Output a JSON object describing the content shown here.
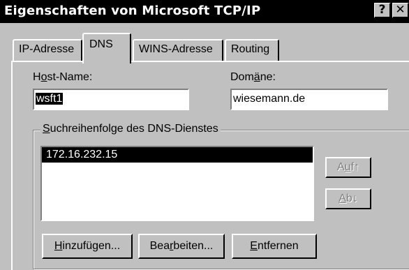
{
  "window": {
    "title": "Eigenschaften von Microsoft TCP/IP",
    "help_button": "?",
    "close_button": "✕"
  },
  "tabs": [
    {
      "label": "IP-Adresse",
      "active": false
    },
    {
      "label": "DNS",
      "active": true
    },
    {
      "label": "WINS-Adresse",
      "active": false
    },
    {
      "label": "Routing",
      "active": false
    }
  ],
  "host": {
    "label_pre": "H",
    "label_u": "o",
    "label_post": "st-Name:",
    "value": "wsft1"
  },
  "domain": {
    "label_pre": "Dom",
    "label_u": "ä",
    "label_post": "ne:",
    "value": "wiesemann.de"
  },
  "dns_order": {
    "legend_u": "S",
    "legend_post": "uchreihenfolge des DNS-Dienstes",
    "items": [
      "172.16.232.15"
    ]
  },
  "buttons": {
    "up_pre": "A",
    "up_u": "u",
    "up_post": "f↑",
    "down_u": "A",
    "down_post": "b↓",
    "add_u": "H",
    "add_post": "inzufügen...",
    "edit_pre": "Bea",
    "edit_u": "r",
    "edit_post": "beiten...",
    "remove_u": "E",
    "remove_post": "ntfernen"
  }
}
